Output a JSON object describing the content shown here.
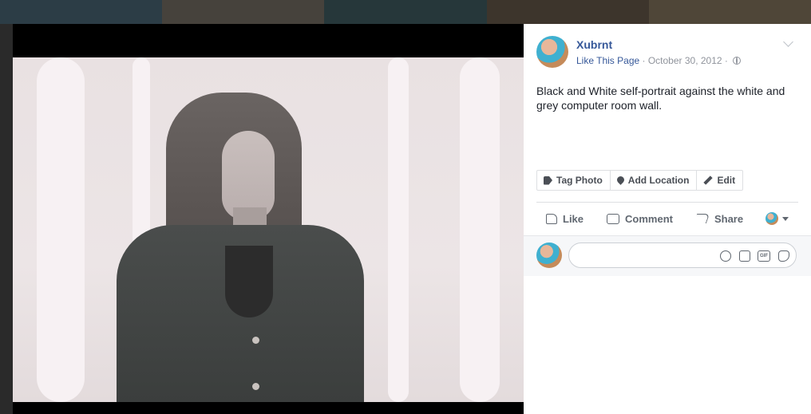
{
  "post": {
    "page_name": "Xubrnt",
    "like_page_label": "Like This Page",
    "separator": " · ",
    "date": "October 30, 2012",
    "date_separator": " · ",
    "caption": "Black and White self-portrait against the white and grey computer room wall."
  },
  "photo_toolbar": {
    "tag_photo": "Tag Photo",
    "add_location": "Add Location",
    "edit": "Edit"
  },
  "actions": {
    "like": "Like",
    "comment": "Comment",
    "share": "Share"
  },
  "comment_box": {
    "gif_label": "GIF"
  },
  "icons": [
    "globe-icon",
    "chevron-down-icon",
    "tag-icon",
    "location-pin-icon",
    "pencil-icon",
    "thumbs-up-icon",
    "comment-icon",
    "share-icon",
    "emoji-icon",
    "camera-icon",
    "gif-icon",
    "sticker-icon"
  ],
  "colors": {
    "link": "#365899",
    "meta": "#90949c",
    "text": "#1d2129",
    "action": "#606770"
  }
}
